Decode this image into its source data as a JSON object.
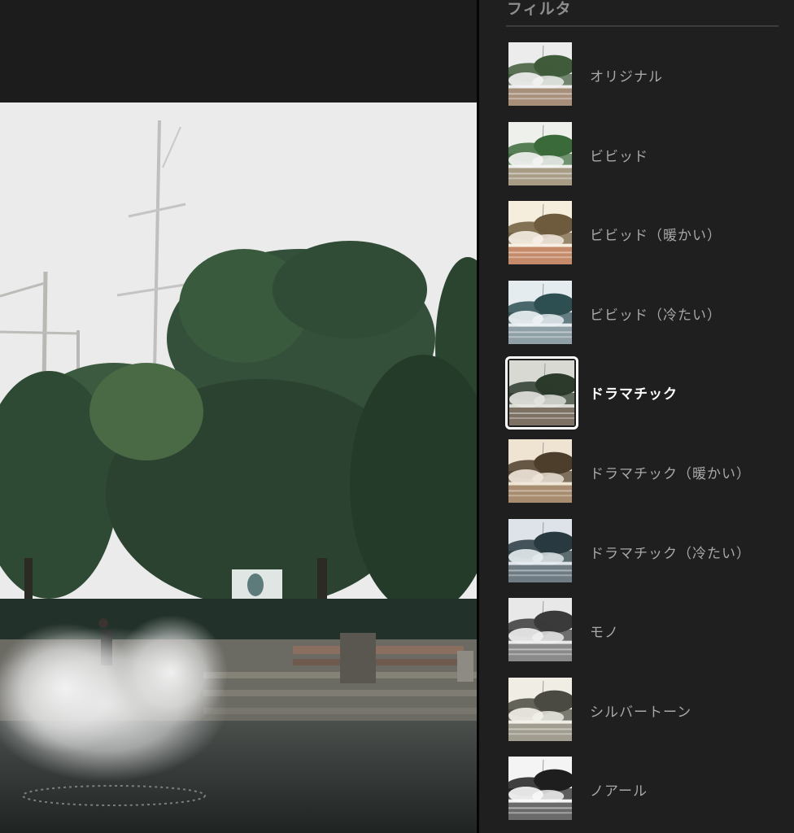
{
  "panel": {
    "title": "フィルタ"
  },
  "filters": [
    {
      "label": "オリジナル",
      "sky": "#ececec",
      "tree": "#3f5b3a",
      "ground": "#a88f7a",
      "mist": "#f2f2f2"
    },
    {
      "label": "ビビッド",
      "sky": "#eef0ec",
      "tree": "#3b6a3a",
      "ground": "#a89c86",
      "mist": "#f4f4f4"
    },
    {
      "label": "ビビッド（暖かい）",
      "sky": "#f6eedc",
      "tree": "#6e5a3c",
      "ground": "#c48a6a",
      "mist": "#f7efe6"
    },
    {
      "label": "ビビッド（冷たい）",
      "sky": "#e4ecf0",
      "tree": "#2e4f52",
      "ground": "#8fa0a6",
      "mist": "#eef3f6"
    },
    {
      "label": "ドラマチック",
      "sky": "#d9d9d4",
      "tree": "#2b3a2b",
      "ground": "#7d7164",
      "mist": "#e4e4e0",
      "selected": true
    },
    {
      "label": "ドラマチック（暖かい）",
      "sky": "#efe4d2",
      "tree": "#4d3e2c",
      "ground": "#a88c70",
      "mist": "#efe6da"
    },
    {
      "label": "ドラマチック（冷たい）",
      "sky": "#dde3e8",
      "tree": "#283a40",
      "ground": "#6f7c84",
      "mist": "#e6ecf0"
    },
    {
      "label": "モノ",
      "sky": "#e8e8e8",
      "tree": "#3a3a3a",
      "ground": "#8a8a8a",
      "mist": "#f0f0f0"
    },
    {
      "label": "シルバートーン",
      "sky": "#efede4",
      "tree": "#4a4a42",
      "ground": "#a19d90",
      "mist": "#f3f1ea"
    },
    {
      "label": "ノアール",
      "sky": "#f4f4f4",
      "tree": "#1e1e1e",
      "ground": "#6a6a6a",
      "mist": "#fafafa"
    }
  ]
}
